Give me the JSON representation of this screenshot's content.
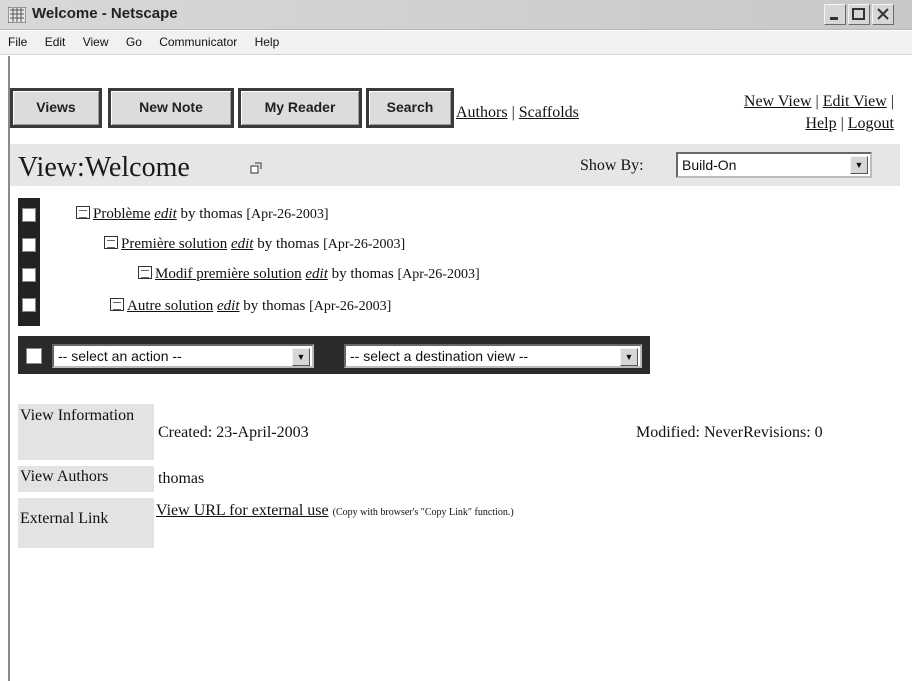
{
  "window": {
    "title": "Welcome - Netscape"
  },
  "menu": [
    "File",
    "Edit",
    "View",
    "Go",
    "Communicator",
    "Help"
  ],
  "toolbar": {
    "buttons": [
      "Views",
      "New Note",
      "My Reader",
      "Search"
    ],
    "links": [
      "Authors",
      "Scaffolds"
    ],
    "right_links": [
      "New View",
      "Edit View",
      "Help",
      "Logout"
    ]
  },
  "view": {
    "prefix": "View:",
    "name": "Welcome",
    "show_by_label": "Show By:",
    "show_by_value": "Build-On"
  },
  "notes": [
    {
      "title": "Problème",
      "edit": "edit",
      "by": "by thomas",
      "date": "[Apr-26-2003]"
    },
    {
      "title": "Première solution",
      "edit": "edit",
      "by": "by thomas",
      "date": "[Apr-26-2003]"
    },
    {
      "title": "Modif première solution",
      "edit": "edit",
      "by": "by thomas",
      "date": "[Apr-26-2003]"
    },
    {
      "title": "Autre solution",
      "edit": "edit",
      "by": "by thomas",
      "date": "[Apr-26-2003]"
    }
  ],
  "actions": {
    "action_select": "-- select an action --",
    "destination_select": "-- select a destination view --"
  },
  "info": {
    "view_info_label": "View Information",
    "created": "Created: 23-April-2003",
    "modified": "Modified: NeverRevisions: 0",
    "authors_label": "View Authors",
    "authors_value": "thomas",
    "external_label": "External Link",
    "external_link": "View URL for external use",
    "external_note": "(Copy with browser's \"Copy Link\" function.)"
  }
}
